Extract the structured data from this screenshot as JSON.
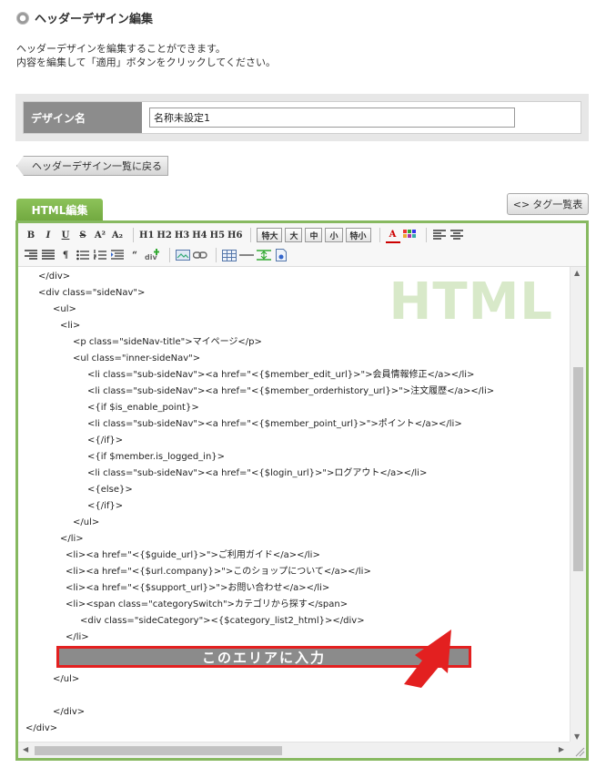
{
  "page": {
    "title": "ヘッダーデザイン編集",
    "description_line1": "ヘッダーデザインを編集することができます。",
    "description_line2": "内容を編集して「適用」ボタンをクリックしてください。"
  },
  "form": {
    "label": "デザイン名",
    "value": "名称未設定1"
  },
  "back_button": "ヘッダーデザイン一覧に戻る",
  "tabs": {
    "html_edit": "HTML編集"
  },
  "tag_list_button": "タグ一覧表",
  "toolbar": {
    "bold": "B",
    "italic": "I",
    "underline": "U",
    "strike": "S",
    "superscript": "A²",
    "subscript": "A₂",
    "h1": "H1",
    "h2": "H2",
    "h3": "H3",
    "h4": "H4",
    "h5": "H5",
    "h6": "H6",
    "size_xl": "特大",
    "size_l": "大",
    "size_m": "中",
    "size_s": "小",
    "size_xs": "特小",
    "font_color_icon": "A",
    "paragraph": "¶",
    "quote": "“"
  },
  "editor": {
    "watermark": "HTML",
    "code_lines": [
      "</div>",
      "<div class=\"sideNav\">",
      "<ul>",
      "<li>",
      "<p class=\"sideNav-title\">マイページ</p>",
      "<ul class=\"inner-sideNav\">",
      "<li class=\"sub-sideNav\"><a href=\"<{$member_edit_url}>\">会員情報修正</a></li>",
      "<li class=\"sub-sideNav\"><a href=\"<{$member_orderhistory_url}>\">注文履歴</a></li>",
      "<{if $is_enable_point}>",
      "<li class=\"sub-sideNav\"><a href=\"<{$member_point_url}>\">ポイント</a></li>",
      "<{/if}>",
      "<{if $member.is_logged_in}>",
      "<li class=\"sub-sideNav\"><a href=\"<{$login_url}>\">ログアウト</a></li>",
      "<{else}>",
      "<{/if}>",
      "</ul>",
      "</li>",
      "<li><a href=\"<{$guide_url}>\">ご利用ガイド</a></li>",
      "<li><a href=\"<{$url.company}>\">このショップについて</a></li>",
      "<li><a href=\"<{$support_url}>\">お問い合わせ</a></li>",
      "<li><span class=\"categorySwitch\">カテゴリから探す</span>",
      "<div class=\"sideCategory\"><{$category_list2_html}></div>",
      "</li>",
      "",
      "</ul>",
      "",
      "</div>",
      "</div>"
    ],
    "input_area_label": "このエリアに入力"
  },
  "colors": {
    "accent_green": "#87b960",
    "highlight_red": "#e32020"
  }
}
